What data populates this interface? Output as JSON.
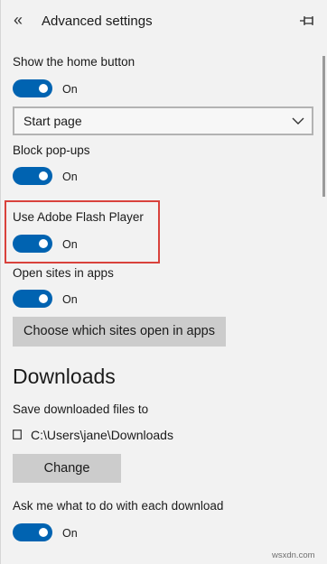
{
  "header": {
    "title": "Advanced settings"
  },
  "settings": {
    "home_button": {
      "label": "Show the home button",
      "state": "On"
    },
    "start_select": {
      "value": "Start page"
    },
    "popups": {
      "label": "Block pop-ups",
      "state": "On"
    },
    "flash": {
      "label": "Use Adobe Flash Player",
      "state": "On"
    },
    "open_apps": {
      "label": "Open sites in apps",
      "state": "On"
    },
    "choose_sites_button": "Choose which sites open in apps"
  },
  "downloads": {
    "title": "Downloads",
    "save_label": "Save downloaded files to",
    "path": "C:\\Users\\jane\\Downloads",
    "change_button": "Change",
    "ask": {
      "label": "Ask me what to do with each download",
      "state": "On"
    }
  },
  "colors": {
    "toggle_on": "#0063b1",
    "highlight": "#d9423c",
    "button": "#cccccc"
  },
  "watermark": "wsxdn.com"
}
